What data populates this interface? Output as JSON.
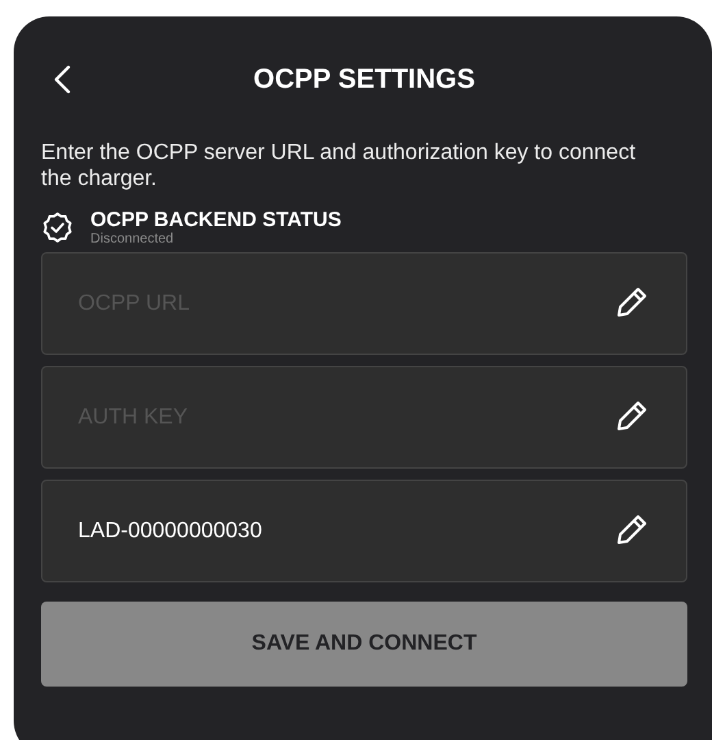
{
  "header": {
    "title": "OCPP SETTINGS"
  },
  "description": "Enter the OCPP server URL and authorization key to connect the charger.",
  "status": {
    "title": "OCPP BACKEND STATUS",
    "value": "Disconnected"
  },
  "fields": [
    {
      "placeholder": "OCPP URL"
    },
    {
      "placeholder": "AUTH KEY"
    },
    {
      "value": "LAD-00000000030"
    }
  ],
  "button": {
    "label": "SAVE AND CONNECT",
    "disabled": true
  }
}
